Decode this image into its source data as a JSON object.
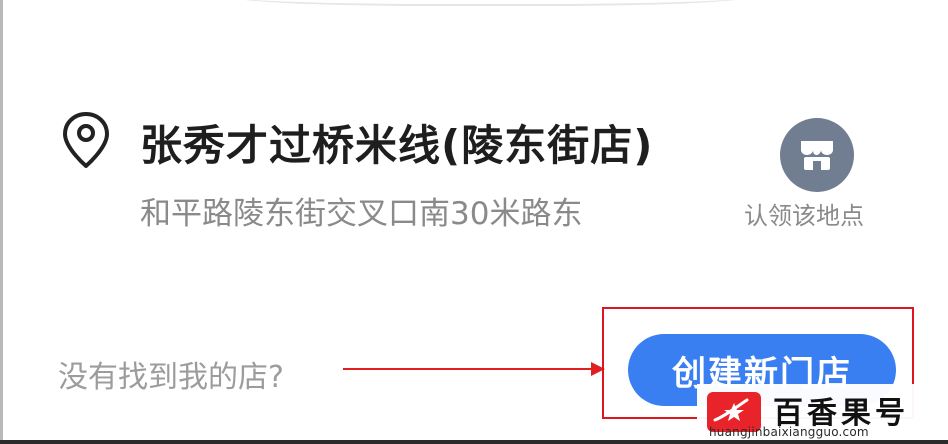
{
  "place": {
    "name": "张秀才过桥米线(陵东街店)",
    "address": "和平路陵东街交叉口南30米路东",
    "claim_label": "认领该地点"
  },
  "footer": {
    "not_found_text": "没有找到我的店?",
    "create_button": "创建新门店"
  },
  "watermark": {
    "brand": "百香果号",
    "url": "huangjinbaixiangguo.com"
  },
  "colors": {
    "accent": "#3a7ff2",
    "annotation": "#e0141e",
    "claim_icon_bg": "#717d91"
  },
  "icons": [
    "location-pin-icon",
    "store-icon",
    "arrow-right-icon",
    "brand-logo-icon"
  ]
}
